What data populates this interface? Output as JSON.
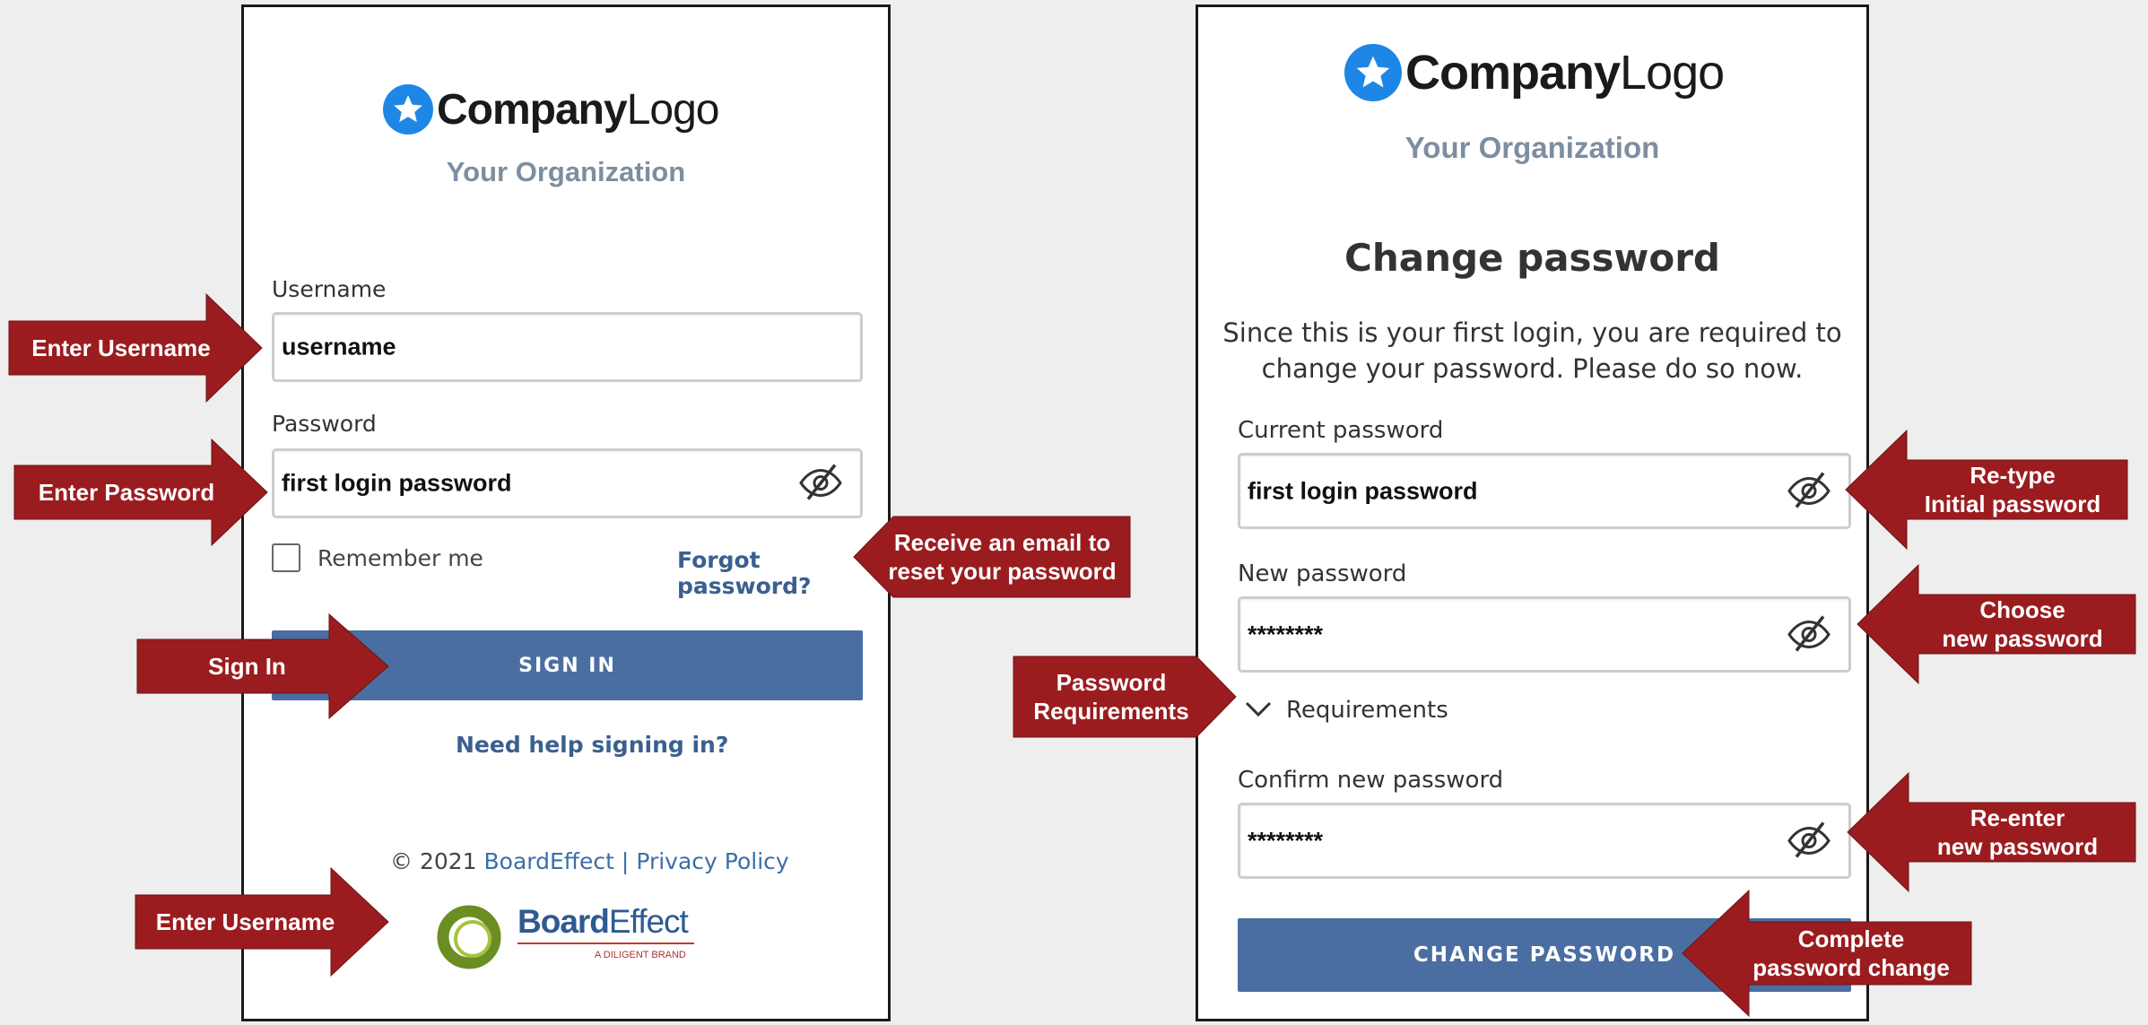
{
  "login": {
    "logo": {
      "bold": "Company",
      "light": "Logo"
    },
    "org": "Your Organization",
    "username_label": "Username",
    "username_value": "username",
    "password_label": "Password",
    "password_value": "first login password",
    "remember_label": "Remember me",
    "forgot_link": "Forgot password?",
    "signin_button": "SIGN IN",
    "help_link": "Need help signing in?",
    "footer_copy": "© 2021",
    "footer_brand": "BoardEffect",
    "footer_sep": "|",
    "footer_privacy": "Privacy Policy",
    "brand_logo": {
      "bold": "Board",
      "light": "Effect",
      "tagline": "A DILIGENT BRAND"
    }
  },
  "change": {
    "logo": {
      "bold": "Company",
      "light": "Logo"
    },
    "org": "Your Organization",
    "title": "Change password",
    "message_line1": "Since this is your first login, you are required to",
    "message_line2": "change your password. Please do so now.",
    "current_label": "Current password",
    "current_value": "first login password",
    "new_label": "New password",
    "new_value": "********",
    "requirements_label": "Requirements",
    "confirm_label": "Confirm new password",
    "confirm_value": "********",
    "submit_button": "CHANGE PASSWORD"
  },
  "callouts": {
    "enter_username": "Enter Username",
    "enter_password": "Enter Password",
    "forgot": {
      "line1": "Receive an email to",
      "line2": "reset your password"
    },
    "sign_in": "Sign In",
    "enter_username_footer": "Enter Username",
    "retype": {
      "line1": "Re-type",
      "line2": "Initial password"
    },
    "choose": {
      "line1": "Choose",
      "line2": "new password"
    },
    "requirements": {
      "line1": "Password",
      "line2": "Requirements"
    },
    "reenter": {
      "line1": "Re-enter",
      "line2": "new password"
    },
    "complete": {
      "line1": "Complete",
      "line2": "password  change"
    }
  },
  "colors": {
    "callout": "#9b1c1f",
    "button": "#4a6ea1",
    "logo_star": "#1e87e5",
    "link": "#3b5f8f"
  }
}
